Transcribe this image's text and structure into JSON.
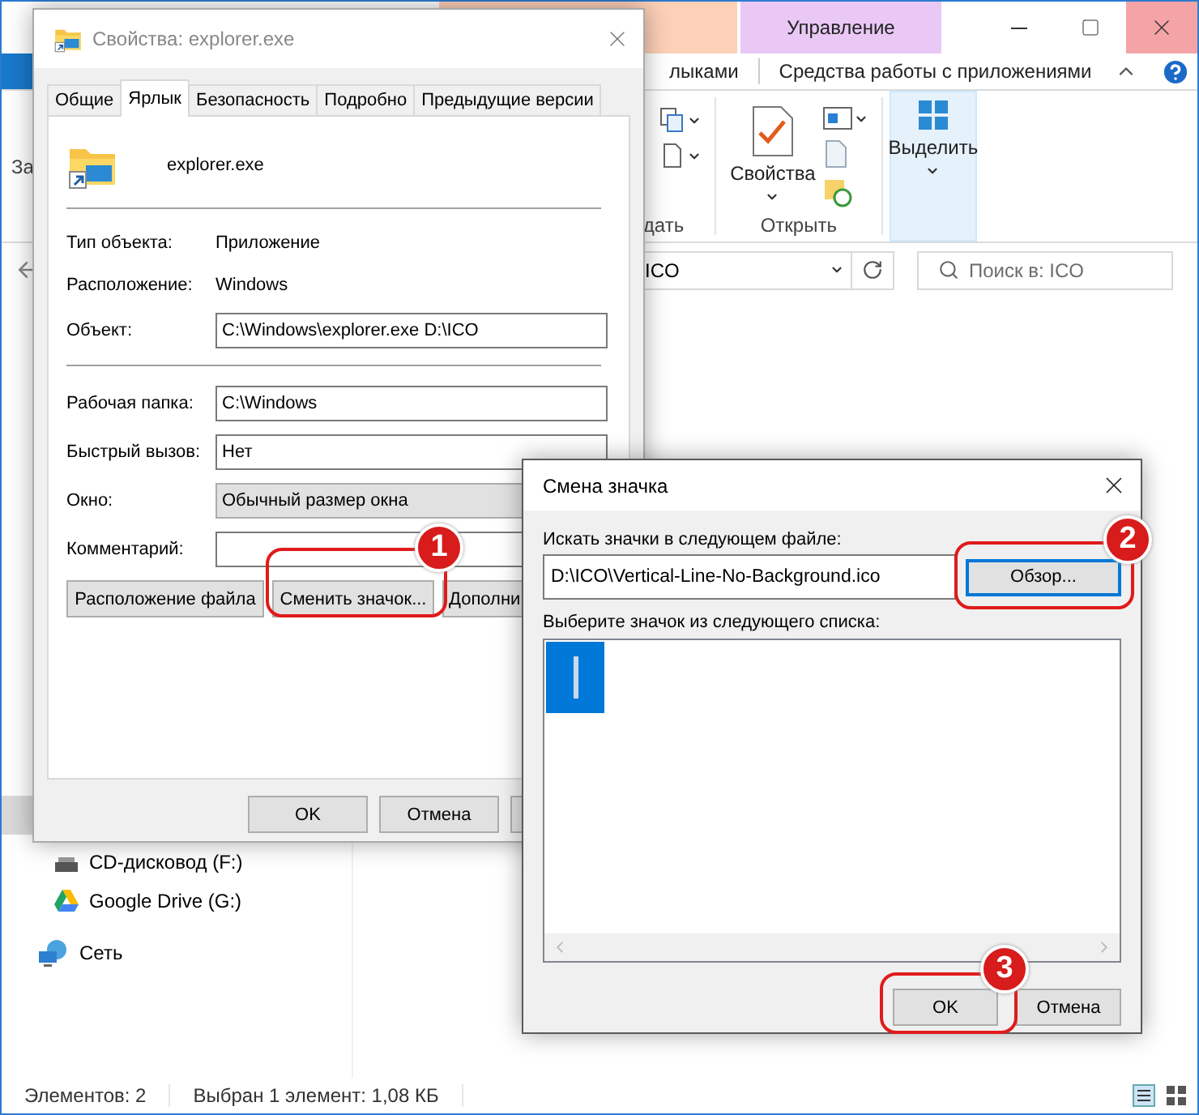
{
  "explorer": {
    "context_tab": {
      "label": "Управление"
    },
    "ribbon_tabs": [
      "лыками",
      "Средства работы с приложениями"
    ],
    "ribbon": {
      "left_fragment": "За",
      "group_fragment": "дать",
      "open_group": "Открыть",
      "properties_button": "Свойства",
      "select_button": "Выделить"
    },
    "address": "ICO",
    "search": {
      "placeholder": "Поиск в: ICO"
    },
    "nav": [
      {
        "label": "CD-дисковод (F:)",
        "kind": "cd"
      },
      {
        "label": "Google Drive (G:)",
        "kind": "drive"
      },
      {
        "label": "Сеть",
        "kind": "network"
      }
    ],
    "status_bar": [
      "Элементов: 2",
      "Выбран 1 элемент: 1,08 КБ"
    ]
  },
  "properties": {
    "title": "Свойства: explorer.exe",
    "tabs": [
      {
        "label": "Общие",
        "selected": false
      },
      {
        "label": "Ярлык",
        "selected": true
      },
      {
        "label": "Безопасность",
        "selected": false
      },
      {
        "label": "Подробно",
        "selected": false
      },
      {
        "label": "Предыдущие версии",
        "selected": false
      }
    ],
    "file_name": "explorer.exe",
    "info": [
      {
        "label": "Тип объекта:",
        "value": "Приложение"
      },
      {
        "label": "Расположение:",
        "value": "Windows"
      }
    ],
    "object": {
      "label": "Объект:",
      "value": "C:\\Windows\\explorer.exe D:\\ICO"
    },
    "fields": [
      {
        "label": "Рабочая папка:",
        "value": "C:\\Windows",
        "kind": "text"
      },
      {
        "label": "Быстрый вызов:",
        "value": "Нет",
        "kind": "text"
      },
      {
        "label": "Окно:",
        "value": "Обычный размер окна",
        "kind": "select"
      },
      {
        "label": "Комментарий:",
        "kind": "text"
      }
    ],
    "buttons": [
      "Расположение файла",
      "Сменить значок...",
      "Дополни"
    ],
    "footer": [
      "OK",
      "Отмена"
    ]
  },
  "change_icon": {
    "title": "Смена значка",
    "file_label": "Искать значки в следующем файле:",
    "file_value": "D:\\ICO\\Vertical-Line-No-Background.ico",
    "browse_button": "Обзор...",
    "list_label": "Выберите значок из следующего списка:",
    "icons": [
      {
        "selected": true
      }
    ],
    "footer": [
      "OK",
      "Отмена"
    ]
  },
  "callouts": [
    "1",
    "2",
    "3"
  ]
}
